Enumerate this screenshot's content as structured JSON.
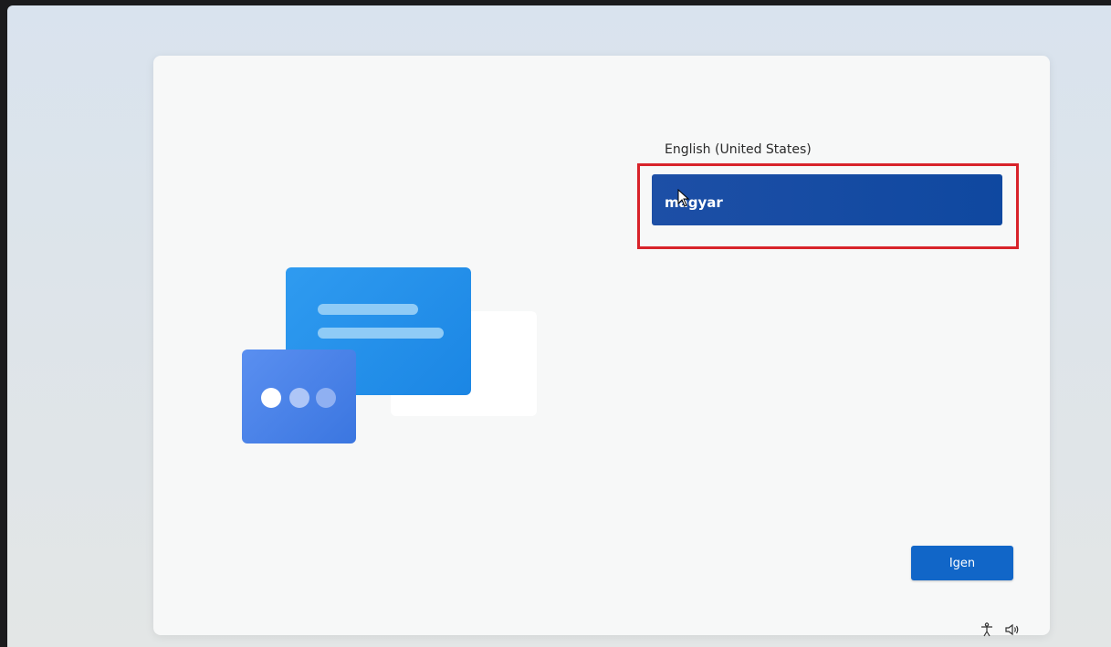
{
  "languages": {
    "options": [
      "English (United States)"
    ],
    "selected": "magyar"
  },
  "buttons": {
    "yes_label": "Igen"
  },
  "tray": {
    "accessibility_icon": "accessibility-icon",
    "volume_icon": "volume-icon"
  },
  "colors": {
    "accent": "#1166c8",
    "selected_bg": "#1d4fa6",
    "highlight_border": "#d8232a"
  }
}
